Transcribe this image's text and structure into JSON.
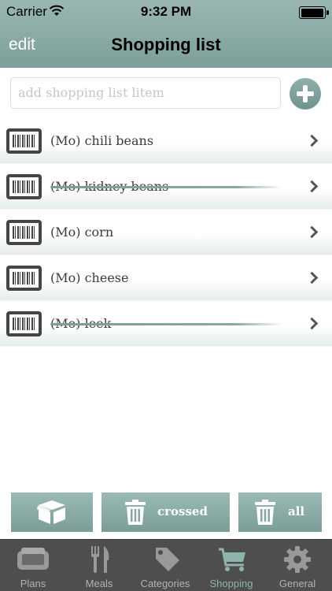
{
  "status": {
    "carrier": "Carrier",
    "time": "9:32 PM"
  },
  "nav": {
    "edit_label": "edit",
    "title": "Shopping list"
  },
  "add": {
    "placeholder": "add shopping list litem"
  },
  "items": [
    {
      "label": "(Mo) chili beans",
      "crossed": false
    },
    {
      "label": "(Mo) kidney beans",
      "crossed": true
    },
    {
      "label": "(Mo) corn",
      "crossed": false
    },
    {
      "label": "(Mo) cheese",
      "crossed": false
    },
    {
      "label": "(Mo) leek",
      "crossed": true
    }
  ],
  "buttons": {
    "crossed_label": "crossed",
    "all_label": "all"
  },
  "tabs": [
    {
      "label": "Plans",
      "icon": "plans-icon",
      "active": false
    },
    {
      "label": "Meals",
      "icon": "fork-knife-icon",
      "active": false
    },
    {
      "label": "Categories",
      "icon": "tag-icon",
      "active": false
    },
    {
      "label": "Shopping",
      "icon": "cart-icon",
      "active": true
    },
    {
      "label": "General",
      "icon": "gear-icon",
      "active": false
    }
  ],
  "colors": {
    "accent": "#7d9f99",
    "tab_active": "#8fb3ad",
    "tabbar": "#4e4e4e"
  }
}
